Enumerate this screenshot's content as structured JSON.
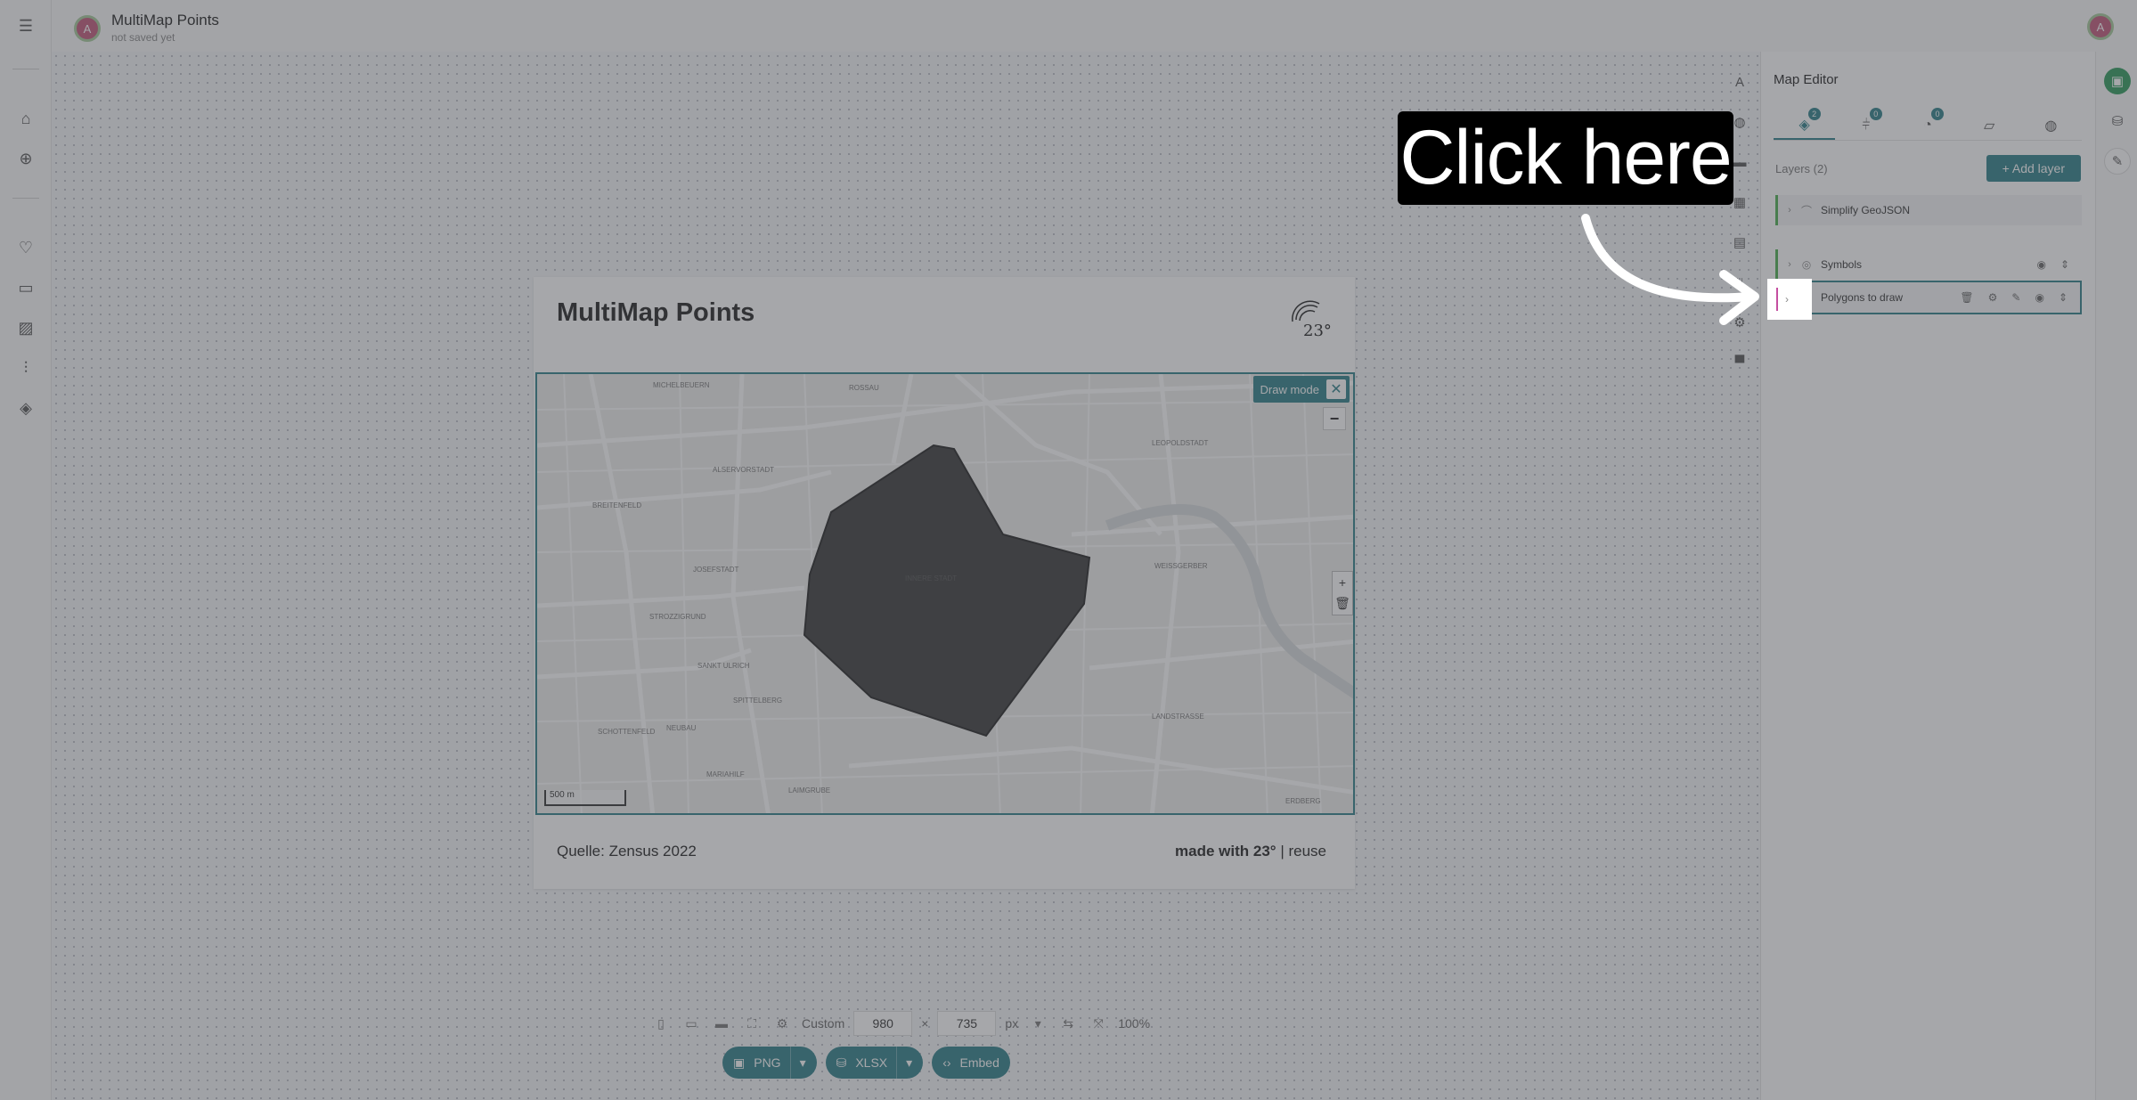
{
  "app": {
    "doc_title": "MultiMap Points",
    "doc_status": "not saved yet",
    "avatar_initial": "A"
  },
  "left_rail": {
    "icons": [
      "menu-icon",
      "home-icon",
      "plus-circle-icon",
      "heart-icon",
      "folder-icon",
      "image-icon",
      "sliders-icon",
      "layers-icon"
    ]
  },
  "map": {
    "title": "MultiMap Points",
    "logo_text": "23°",
    "draw_mode_label": "Draw mode",
    "scale_label": "500 m",
    "source": "Quelle: Zensus 2022",
    "made_with": "made with 23°",
    "reuse": "reuse",
    "place_labels": [
      "MICHELBEUERN",
      "ROSSAU",
      "LEOPOLDSTADT",
      "ALSERVORSTADT",
      "BREITENFELD",
      "JOSEFSTADT",
      "INNERE STADT",
      "WEISSGERBER",
      "STROZZIGRUND",
      "SANKT ULRICH",
      "SPITTELBERG",
      "NEUBAU",
      "SCHOTTENFELD",
      "LANDSTRASSE",
      "MARIAHILF",
      "LAIMGRUBE",
      "ERDBERG"
    ]
  },
  "bottom_toolbar": {
    "preset_label": "Custom",
    "width": "980",
    "times": "×",
    "height": "735",
    "unit": "px",
    "zoom": "100%"
  },
  "export": {
    "png": "PNG",
    "xlsx": "XLSX",
    "embed": "Embed"
  },
  "panel": {
    "title": "Map Editor",
    "tabs": [
      {
        "icon": "layers-icon",
        "badge": "2"
      },
      {
        "icon": "filter-icon",
        "badge": "0"
      },
      {
        "icon": "palette-icon",
        "badge": "0"
      },
      {
        "icon": "map-icon",
        "badge": ""
      },
      {
        "icon": "globe-icon",
        "badge": ""
      }
    ],
    "layers_label": "Layers (2)",
    "add_layer": "+ Add layer",
    "layers": [
      {
        "name": "Simplify GeoJSON"
      },
      {
        "name": "Symbols"
      },
      {
        "name": "Polygons to draw"
      }
    ]
  },
  "tutorial": {
    "callout": "Click here"
  },
  "colors": {
    "accent": "#2c7f88",
    "layer_green": "#4caf50",
    "layer_pink": "#c54ea0",
    "polygon": "#3a3a3a"
  }
}
